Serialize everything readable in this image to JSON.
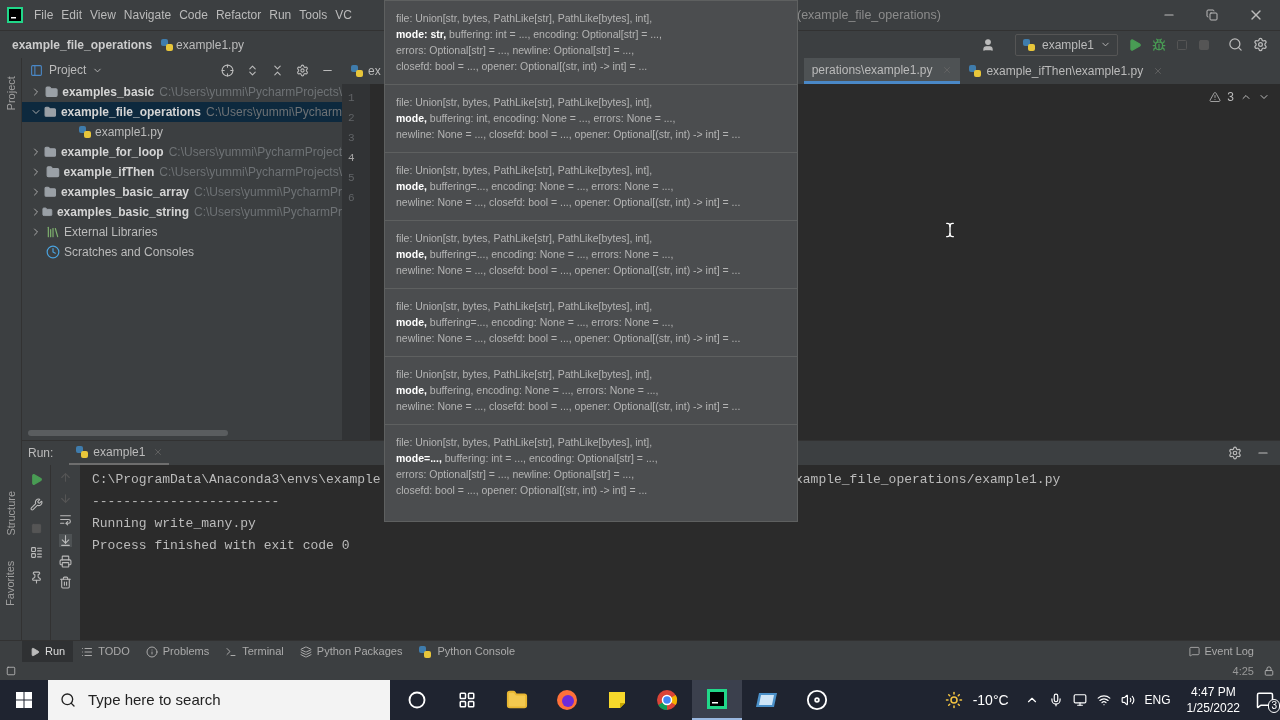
{
  "menu": [
    "File",
    "Edit",
    "View",
    "Navigate",
    "Code",
    "Refactor",
    "Run",
    "Tools",
    "VC"
  ],
  "title": "(example_file_operations)",
  "breadcrumb": [
    {
      "label": "example_file_operations",
      "kind": "folder"
    },
    {
      "label": "example1.py",
      "kind": "file"
    }
  ],
  "run_config": "example1",
  "project_panel": {
    "title": "Project",
    "tree": [
      {
        "name": "examples_basic",
        "path": "C:\\Users\\yummi\\PycharmProjects\\",
        "kind": "folder",
        "expanded": false,
        "selected": false
      },
      {
        "name": "example_file_operations",
        "path": "C:\\Users\\yummi\\Pycharm",
        "kind": "folder",
        "expanded": true,
        "selected": true,
        "children": [
          {
            "name": "example1.py",
            "kind": "file",
            "selected": false
          }
        ]
      },
      {
        "name": "example_for_loop",
        "path": "C:\\Users\\yummi\\PycharmProject",
        "kind": "folder",
        "expanded": false,
        "selected": false
      },
      {
        "name": "example_ifThen",
        "path": "C:\\Users\\yummi\\PycharmProjects\\",
        "kind": "folder",
        "expanded": false,
        "selected": false
      },
      {
        "name": "examples_basic_array",
        "path": "C:\\Users\\yummi\\PycharmPr",
        "kind": "folder",
        "expanded": false,
        "selected": false
      },
      {
        "name": "examples_basic_string",
        "path": "C:\\Users\\yummi\\PycharmPr",
        "kind": "folder",
        "expanded": false,
        "selected": false
      },
      {
        "name": "External Libraries",
        "kind": "library",
        "expanded": false,
        "selected": false
      },
      {
        "name": "Scratches and Consoles",
        "kind": "scratches",
        "selected": false
      }
    ]
  },
  "side_stripe": {
    "top": "Project",
    "bottom": [
      "Structure",
      "Favorites"
    ]
  },
  "editor_tabs": [
    {
      "label": "ex",
      "selected": false
    },
    {
      "label": "perations\\example1.py",
      "selected": true
    },
    {
      "label": "example_ifThen\\example1.py",
      "selected": false
    }
  ],
  "line_numbers": [
    {
      "label": "1",
      "current": false
    },
    {
      "label": "2",
      "current": false
    },
    {
      "label": "3",
      "current": false
    },
    {
      "label": "4",
      "current": true
    },
    {
      "label": "5",
      "current": false
    },
    {
      "label": "6",
      "current": false
    }
  ],
  "warnings": "3",
  "popup": [
    {
      "lines": [
        "file: Union[str, bytes, PathLike[str], PathLike[bytes], int],",
        "**mode: str,** buffering: int = ..., encoding: Optional[str] = ...,",
        "errors: Optional[str] = ..., newline: Optional[str] = ...,",
        "closefd: bool = ..., opener: Optional[(str, int) -> int] = ..."
      ]
    },
    {
      "lines": [
        "file: Union[str, bytes, PathLike[str], PathLike[bytes], int],",
        "**mode,** buffering: int, encoding: None = ..., errors: None = ...,",
        "newline: None = ..., closefd: bool = ..., opener: Optional[(str, int) -> int] = ..."
      ]
    },
    {
      "lines": [
        "file: Union[str, bytes, PathLike[str], PathLike[bytes], int],",
        "**mode,** buffering=..., encoding: None = ..., errors: None = ...,",
        "newline: None = ..., closefd: bool = ..., opener: Optional[(str, int) -> int] = ..."
      ]
    },
    {
      "lines": [
        "file: Union[str, bytes, PathLike[str], PathLike[bytes], int],",
        "**mode,** buffering=..., encoding: None = ..., errors: None = ...,",
        "newline: None = ..., closefd: bool = ..., opener: Optional[(str, int) -> int] = ..."
      ]
    },
    {
      "lines": [
        "file: Union[str, bytes, PathLike[str], PathLike[bytes], int],",
        "**mode,** buffering=..., encoding: None = ..., errors: None = ...,",
        "newline: None = ..., closefd: bool = ..., opener: Optional[(str, int) -> int] = ..."
      ]
    },
    {
      "lines": [
        "file: Union[str, bytes, PathLike[str], PathLike[bytes], int],",
        "**mode,** buffering, encoding: None = ..., errors: None = ...,",
        "newline: None = ..., closefd: bool = ..., opener: Optional[(str, int) -> int] = ..."
      ]
    },
    {
      "lines": [
        "file: Union[str, bytes, PathLike[str], PathLike[bytes], int],",
        "**mode=...,** buffering: int = ..., encoding: Optional[str] = ...,",
        "errors: Optional[str] = ..., newline: Optional[str] = ...,",
        "closefd: bool = ..., opener: Optional[(str, int) -> int] = ..."
      ]
    }
  ],
  "run_panel": {
    "label": "Run:",
    "tab": "example1",
    "console": [
      {
        "left": "C:\\ProgramData\\Anaconda3\\envs\\example",
        "right": "xample_file_operations/example1.py"
      },
      {
        "left": "------------------------"
      },
      {
        "left": "Running write_many.py"
      },
      {
        "left": "Process finished with exit code 0"
      }
    ]
  },
  "tool_windows": [
    {
      "label": "Run",
      "kind": "play",
      "selected": true
    },
    {
      "label": "TODO",
      "kind": "list",
      "selected": false
    },
    {
      "label": "Problems",
      "kind": "info",
      "selected": false
    },
    {
      "label": "Terminal",
      "kind": "terminal",
      "selected": false
    },
    {
      "label": "Python Packages",
      "kind": "layers",
      "selected": false
    },
    {
      "label": "Python Console",
      "kind": "python",
      "selected": false
    }
  ],
  "event_log": "Event Log",
  "status": {
    "position": "4:25"
  },
  "taskbar": {
    "search_placeholder": "Type here to search",
    "apps": [
      {
        "kind": "cortana",
        "active": false
      },
      {
        "kind": "taskview",
        "active": false
      },
      {
        "kind": "explorer",
        "active": false
      },
      {
        "kind": "firefox",
        "active": false
      },
      {
        "kind": "notes",
        "active": false
      },
      {
        "kind": "chrome",
        "active": false
      },
      {
        "kind": "pycharm",
        "active": true
      },
      {
        "kind": "app",
        "active": false
      },
      {
        "kind": "obs",
        "active": false
      }
    ],
    "weather": "-10°C",
    "language": "ENG",
    "time": "4:47 PM",
    "date": "1/25/2022",
    "notifications": "3"
  }
}
